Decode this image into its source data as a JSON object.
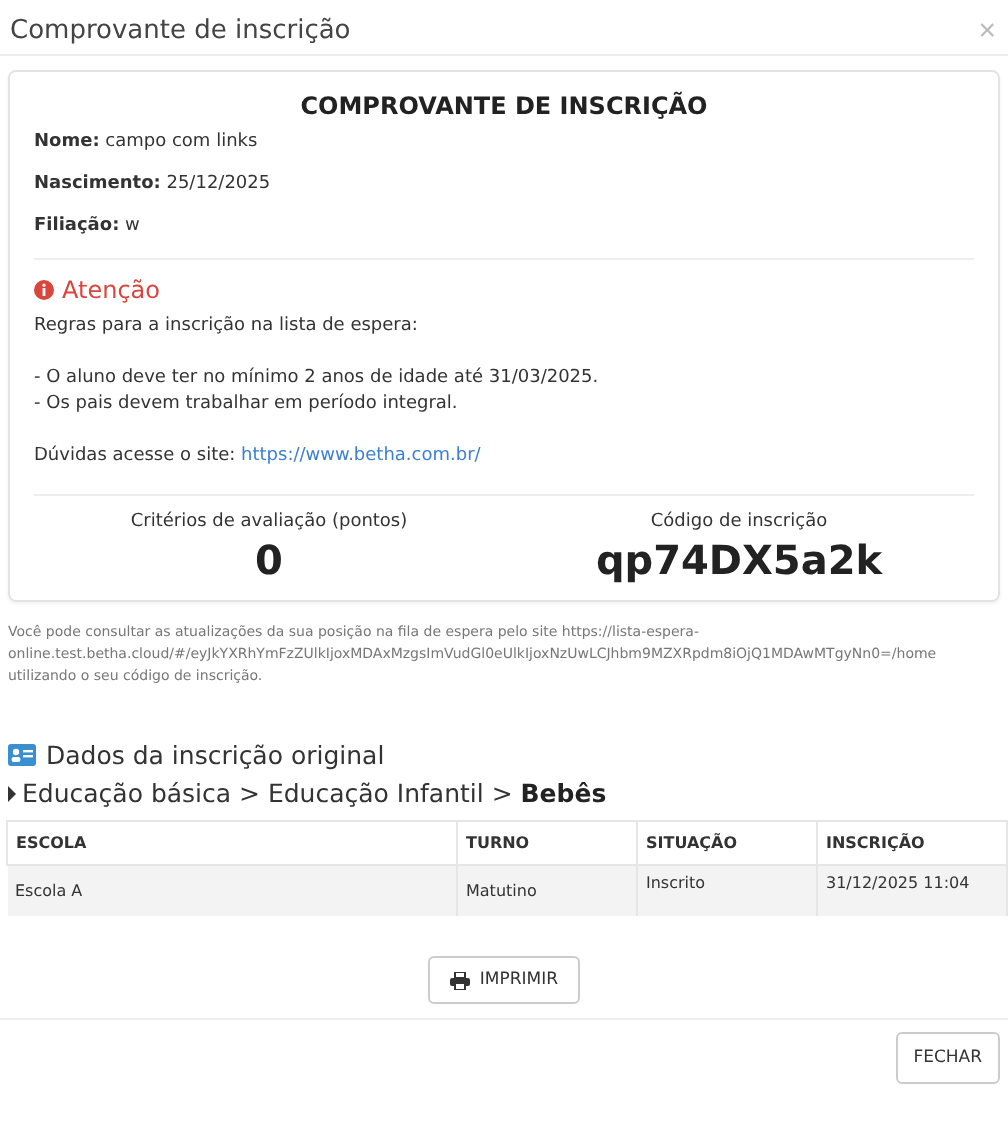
{
  "dialog": {
    "title": "Comprovante de inscrição",
    "close": "×"
  },
  "receipt": {
    "heading": "COMPROVANTE DE INSCRIÇÃO",
    "fields": [
      {
        "label": "Nome:",
        "value": "campo com links"
      },
      {
        "label": "Nascimento:",
        "value": "25/12/2025"
      },
      {
        "label": "Filiação:",
        "value": "w"
      }
    ],
    "notice": {
      "title": "Atenção",
      "intro": "Regras para a inscrição na lista de espera:",
      "rules": [
        "- O aluno deve ter no mínimo 2 anos de idade até 31/03/2025.",
        "- Os pais devem trabalhar em período integral."
      ],
      "help": "Dúvidas acesse o site:",
      "link": "https://www.betha.com.br/"
    },
    "stats": [
      {
        "label": "Critérios de avaliação (pontos)",
        "value": "0"
      },
      {
        "label": "Código de inscrição",
        "value": "qp74DX5a2k"
      }
    ]
  },
  "info_text": "Você pode consultar as atualizações da sua posição na fila de espera pelo site https://lista-espera-online.test.betha.cloud/#/eyJkYXRhYmFzZUlkIjoxMDAxMzgsImVudGl0eUlkIjoxNzUwLCJhbm9MZXRpdm8iOjQ1MDAwMTgyNn0=/home utilizando o seu código de inscrição.",
  "original": {
    "title": "Dados da inscrição original",
    "breadcrumb": "Educação básica > Educação Infantil > **Bebês**",
    "table": {
      "columns": [
        "ESCOLA",
        "TURNO",
        "SITUAÇÃO",
        "INSCRIÇÃO"
      ],
      "rows": [
        [
          "Escola A",
          "Matutino",
          "Inscrito",
          "31/12/2025 11:04"
        ]
      ]
    }
  },
  "print_button": "IMPRIMIR",
  "close_button": "FECHAR"
}
